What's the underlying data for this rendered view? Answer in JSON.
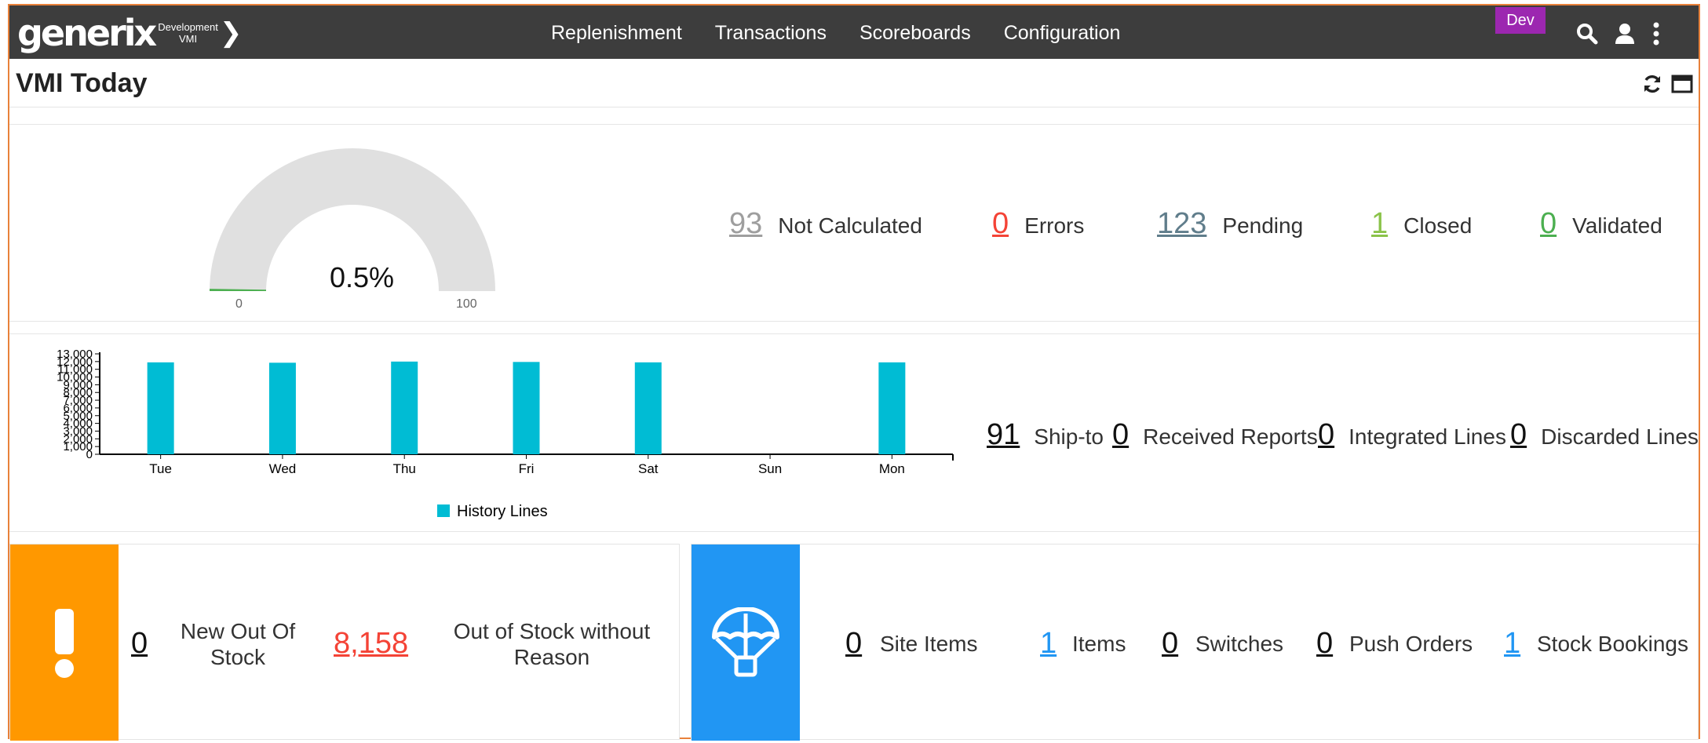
{
  "app": {
    "logo_word": "generix",
    "logo_sub1": "Development",
    "logo_sub2": "VMI",
    "logo_chevron": "❯",
    "env_badge": "Dev"
  },
  "nav": {
    "items": [
      "Replenishment",
      "Transactions",
      "Scoreboards",
      "Configuration"
    ],
    "icons": [
      "search-icon",
      "user-icon",
      "more-vert-icon"
    ]
  },
  "page": {
    "title": "VMI Today",
    "header_icons": [
      "refresh-icon",
      "window-icon"
    ]
  },
  "gauge": {
    "value_label": "0.5%",
    "value": 0.5,
    "min": "0",
    "max": "100",
    "colors": {
      "track": "#e0e0e0",
      "fill": "#4caf50"
    }
  },
  "status_stats": [
    {
      "value": "93",
      "label": "Not Calculated",
      "color": "#9e9e9e"
    },
    {
      "value": "0",
      "label": "Errors",
      "color": "#f44336"
    },
    {
      "value": "123",
      "label": "Pending",
      "color": "#607d8b"
    },
    {
      "value": "1",
      "label": "Closed",
      "color": "#8bc34a"
    },
    {
      "value": "0",
      "label": "Validated",
      "color": "#4caf50"
    }
  ],
  "chart_data": {
    "type": "bar",
    "categories": [
      "Tue",
      "Wed",
      "Thu",
      "Fri",
      "Sat",
      "Sun",
      "Mon"
    ],
    "series": [
      {
        "name": "History Lines",
        "values": [
          11900,
          11850,
          12000,
          11950,
          11900,
          0,
          11900
        ],
        "color": "#00bcd4"
      }
    ],
    "y_ticks": [
      "0",
      "1,000",
      "2,000",
      "3,000",
      "4,000",
      "5,000",
      "6,000",
      "7,000",
      "8,000",
      "9,000",
      "10,000",
      "11,000",
      "12,000",
      "13,000"
    ],
    "ylim": [
      0,
      13000
    ],
    "legend_position": "bottom-center",
    "xlabel": "",
    "ylabel": ""
  },
  "report_stats": [
    {
      "value": "91",
      "label": "Ship-to"
    },
    {
      "value": "0",
      "label": "Received Reports"
    },
    {
      "value": "0",
      "label": "Integrated Lines"
    },
    {
      "value": "0",
      "label": "Discarded Lines"
    }
  ],
  "stock_card": {
    "icon": "exclamation-icon",
    "accent": "#ff9800",
    "new_oos_value": "0",
    "new_oos_label": "New Out Of Stock",
    "no_reason_value": "8,158",
    "no_reason_label": "Out of Stock without Reason",
    "no_reason_color": "#f44336"
  },
  "delivery_card": {
    "icon": "parachute-icon",
    "accent": "#2196f3",
    "stats": [
      {
        "value": "0",
        "label": "Site Items",
        "color": "#111111"
      },
      {
        "value": "1",
        "label": "Items",
        "color": "#2196f3"
      },
      {
        "value": "0",
        "label": "Switches",
        "color": "#111111"
      },
      {
        "value": "0",
        "label": "Push Orders",
        "color": "#111111"
      },
      {
        "value": "1",
        "label": "Stock Bookings",
        "color": "#2196f3"
      }
    ]
  }
}
